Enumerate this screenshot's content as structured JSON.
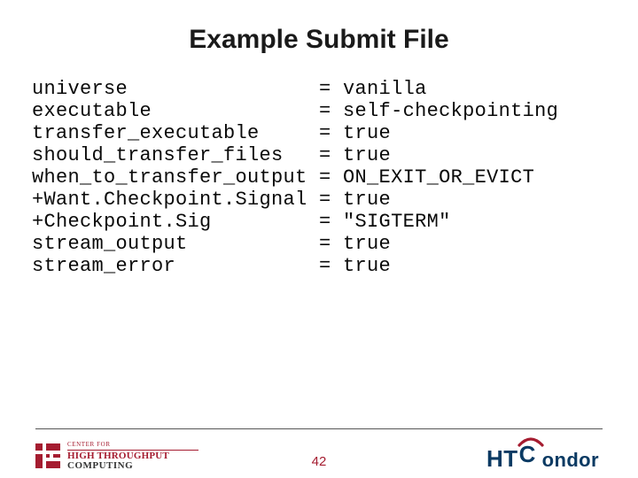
{
  "title": "Example Submit File",
  "page_number": "42",
  "code_lines": [
    {
      "key": "universe",
      "value": "vanilla"
    },
    {
      "key": "executable",
      "value": "self-checkpointing"
    },
    {
      "key": "transfer_executable",
      "value": "true"
    },
    {
      "key": "should_transfer_files",
      "value": "true"
    },
    {
      "key": "when_to_transfer_output",
      "value": "ON_EXIT_OR_EVICT"
    },
    {
      "key": "+Want.Checkpoint.Signal",
      "value": "true"
    },
    {
      "key": "+Checkpoint.Sig",
      "value": "\"SIGTERM\""
    },
    {
      "key": "stream_output",
      "value": "true"
    },
    {
      "key": "stream_error",
      "value": "true"
    }
  ],
  "left_logo": {
    "line1": "CENTER FOR",
    "line2": "HIGH THROUGHPUT",
    "line3": "COMPUTING"
  },
  "right_logo": {
    "prefix": "HT",
    "c": "C",
    "suffix": "ondor"
  },
  "colors": {
    "accent": "#a51c30",
    "navy": "#0a3a63"
  }
}
